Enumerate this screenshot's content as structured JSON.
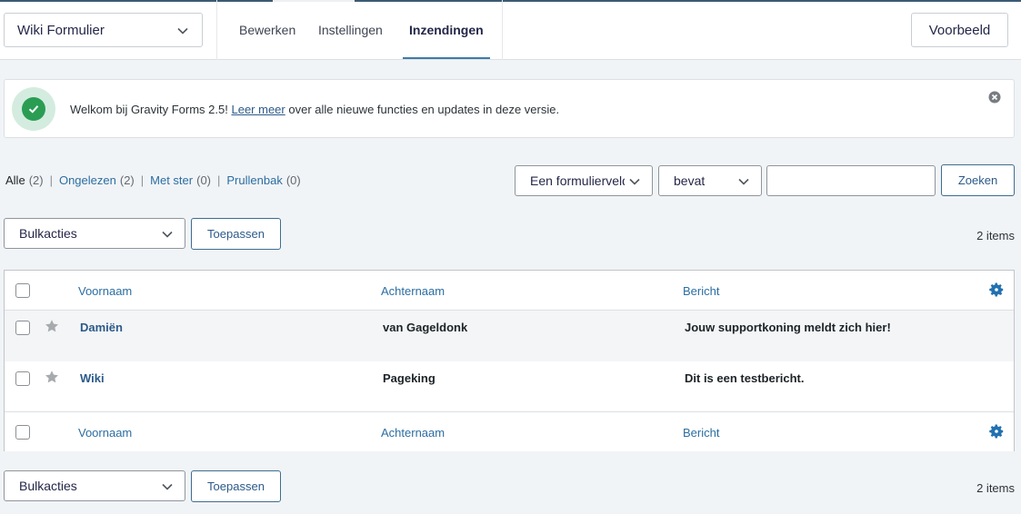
{
  "header": {
    "form_selector": "Wiki Formulier",
    "tabs": [
      "Bewerken",
      "Instellingen",
      "Inzendingen"
    ],
    "active_tab": "Inzendingen",
    "preview_label": "Voorbeeld"
  },
  "notice": {
    "text_before": "Welkom bij Gravity Forms 2.5!",
    "link_text": "Leer meer",
    "text_after": "over alle nieuwe functies en updates in deze versie."
  },
  "views": [
    {
      "label": "Alle",
      "count": "(2)"
    },
    {
      "label": "Ongelezen",
      "count": "(2)"
    },
    {
      "label": "Met ster",
      "count": "(0)"
    },
    {
      "label": "Prullenbak",
      "count": "(0)"
    }
  ],
  "search": {
    "field_select": "Een formulierveld",
    "operator_select": "bevat",
    "value": "",
    "button_label": "Zoeken"
  },
  "bulk": {
    "select_label": "Bulkacties",
    "apply_label": "Toepassen",
    "items_count": "2 items"
  },
  "table": {
    "columns": [
      "Voornaam",
      "Achternaam",
      "Bericht"
    ],
    "rows": [
      {
        "voornaam": "Damiën",
        "achternaam": "van Gageldonk",
        "bericht": "Jouw supportkoning meldt zich hier!"
      },
      {
        "voornaam": "Wiki",
        "achternaam": "Pageking",
        "bericht": "Dit is een testbericht."
      }
    ]
  },
  "colors": {
    "accent": "#2c6ea1",
    "success": "#2a9d53",
    "star": "#a7aaad"
  }
}
